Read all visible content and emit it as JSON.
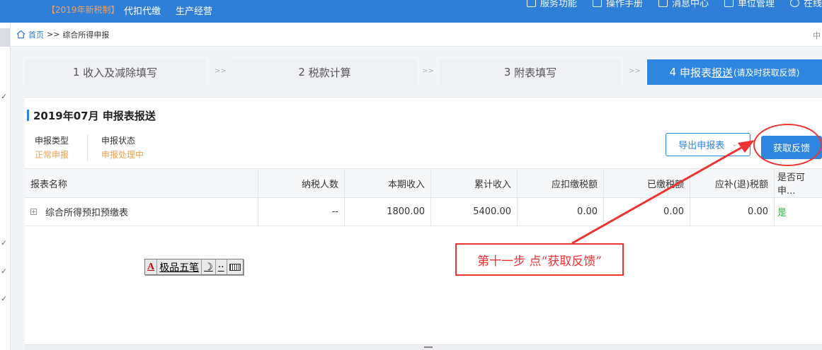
{
  "topbar": {
    "tag": "【2019年新税制】",
    "nav": [
      "代扣代缴",
      "生产经营"
    ],
    "right_items": [
      "服务功能",
      "操作手册",
      "消息中心",
      "单位管理",
      "在线"
    ]
  },
  "breadcrumb": {
    "home": "首页",
    "sep": ">>",
    "current": "综合所得申报",
    "end_mark": "中"
  },
  "leftstrip": {
    "marks": [
      "✓",
      "✓",
      "✓",
      "✓"
    ]
  },
  "steps": [
    {
      "num": "1",
      "label": "收入及减除填写"
    },
    {
      "num": "2",
      "label": "税款计算"
    },
    {
      "num": "3",
      "label": "附表填写"
    },
    {
      "num": "4",
      "label_main": "申报表",
      "label_ul": "报送",
      "label_small": "(请及时获取反馈)"
    }
  ],
  "step_sep": ">>",
  "panel": {
    "title": "2019年07月 申报表报送",
    "meta": [
      {
        "label": "申报类型",
        "value": "正常申报"
      },
      {
        "label": "申报状态",
        "value": "申报处理中"
      }
    ],
    "export_button": "导出申报表",
    "feedback_button": "获取反馈"
  },
  "table": {
    "headers": [
      "报表名称",
      "纳税人数",
      "本期收入",
      "累计收入",
      "应扣缴税额",
      "已缴税额",
      "应补(退)税额",
      "是否可申..."
    ],
    "rows": [
      [
        "综合所得预扣预缴表",
        "--",
        "1800.00",
        "5400.00",
        "0.00",
        "0.00",
        "0.00",
        "是"
      ]
    ]
  },
  "annotation": "第十一步 点“获取反馈”",
  "ime": {
    "logo": "A",
    "name": "极品五笔",
    "moon": "☽",
    "dots": "··"
  },
  "colors": {
    "primary": "#2f86e0",
    "topbar": "#2f7fd8",
    "annotation_red": "#ee3333",
    "status_orange": "#f0a050",
    "yes_green": "#39b54a"
  }
}
